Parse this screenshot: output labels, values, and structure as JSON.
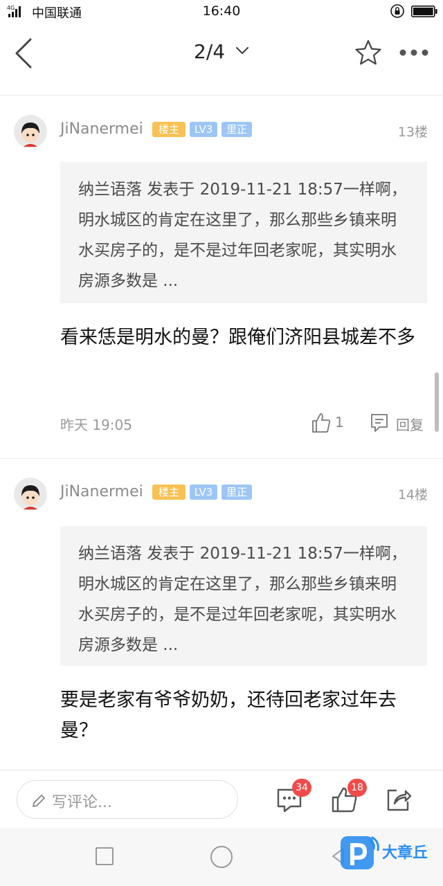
{
  "status_bar": {
    "network": "4G",
    "carrier": "中国联通",
    "time": "16:40"
  },
  "nav": {
    "page_indicator": "2/4"
  },
  "posts": [
    {
      "username": "JiNanermei",
      "badge_host": "楼主",
      "badge_level": "LV3",
      "badge_role": "里正",
      "floor": "13楼",
      "quote": "纳兰语落 发表于 2019-11-21 18:57一样啊，明水城区的肯定在这里了，那么那些乡镇来明水买房子的，是不是过年回老家呢，其实明水房源多数是 ...",
      "content": "看来恁是明水的曼？跟俺们济阳县城差不多",
      "time": "昨天 19:05",
      "likes": "1",
      "reply_label": "回复"
    },
    {
      "username": "JiNanermei",
      "badge_host": "楼主",
      "badge_level": "LV3",
      "badge_role": "里正",
      "floor": "14楼",
      "quote": "纳兰语落 发表于 2019-11-21 18:57一样啊，明水城区的肯定在这里了，那么那些乡镇来明水买房子的，是不是过年回老家呢，其实明水房源多数是 ...",
      "content": "要是老家有爷爷奶奶，还待回老家过年去曼？"
    }
  ],
  "bottom_bar": {
    "comment_placeholder": "写评论...",
    "comment_count": "34",
    "like_count": "18"
  },
  "watermark": {
    "text": "大章丘"
  },
  "colors": {
    "badge_host": "#f7c154",
    "badge_level": "#9dc6f5",
    "notification_badge": "#f04b4b",
    "watermark_blue": "#2c8ef0"
  }
}
